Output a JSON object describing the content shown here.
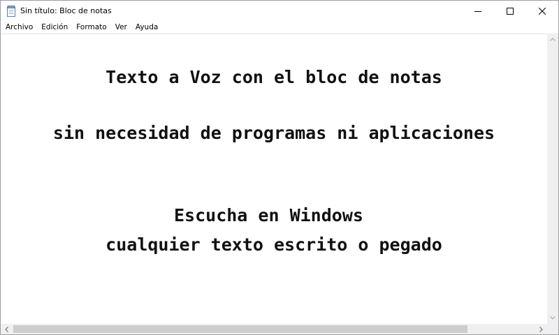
{
  "window": {
    "title": "Sin título: Bloc de notas",
    "icon": "notepad-icon"
  },
  "controls": {
    "minimize_icon": "minimize-icon",
    "maximize_icon": "maximize-icon",
    "close_icon": "close-icon"
  },
  "menu": {
    "items": [
      "Archivo",
      "Edición",
      "Formato",
      "Ver",
      "Ayuda"
    ]
  },
  "editor": {
    "lines": [
      "Texto a Voz con el bloc de notas",
      "sin necesidad de programas ni aplicaciones",
      "Escucha en Windows ",
      "cualquier texto escrito o pegado"
    ]
  },
  "colors": {
    "text": "#111111",
    "scrollbar_track": "#f0f0f0",
    "scrollbar_thumb": "#cdcdcd"
  }
}
